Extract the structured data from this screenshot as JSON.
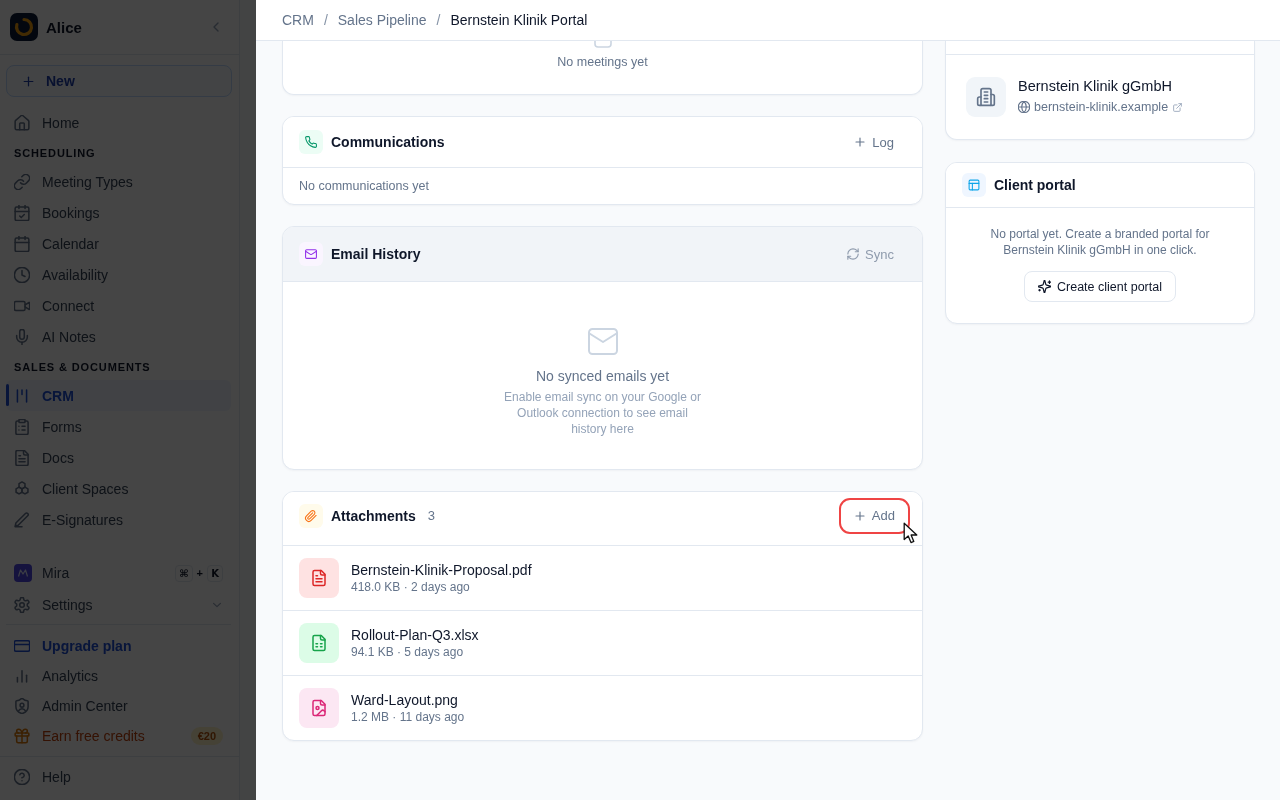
{
  "sidebar": {
    "dimmed": true,
    "workspace": "Alice",
    "new_button": "New",
    "home": {
      "label": "Home",
      "selected": false
    },
    "sections": [
      {
        "title": "SCHEDULING",
        "items": [
          {
            "label": "Meeting Types",
            "selected": false
          },
          {
            "label": "Bookings",
            "selected": false
          },
          {
            "label": "Calendar",
            "selected": false
          },
          {
            "label": "Availability",
            "selected": false
          },
          {
            "label": "Connect",
            "selected": false
          },
          {
            "label": "AI Notes",
            "selected": false
          }
        ]
      },
      {
        "title": "SALES & DOCUMENTS",
        "items": [
          {
            "label": "CRM",
            "selected": true
          },
          {
            "label": "Forms",
            "selected": false
          },
          {
            "label": "Docs",
            "selected": false
          },
          {
            "label": "Client Spaces",
            "selected": false
          },
          {
            "label": "E-Signatures",
            "selected": false
          }
        ]
      }
    ],
    "assistant": {
      "label": "Mira",
      "shortcut": {
        "keys": [
          "⌘",
          "K"
        ],
        "joiner": "+"
      }
    },
    "settings": {
      "label": "Settings",
      "expanded": false
    },
    "footer_items": [
      {
        "kind": "upgrade",
        "label": "Upgrade plan"
      },
      {
        "kind": "link",
        "label": "Analytics"
      },
      {
        "kind": "link",
        "label": "Admin Center"
      },
      {
        "kind": "promo",
        "label": "Earn free credits",
        "badge": "€20"
      }
    ],
    "help": "Help"
  },
  "breadcrumb": [
    {
      "label": "CRM",
      "current": false
    },
    {
      "separator": "/",
      "label": "Sales Pipeline",
      "current": false
    },
    {
      "separator": "/",
      "label": "Bernstein Klinik Portal",
      "current": true
    }
  ],
  "main": {
    "meetings": {
      "empty_text": "No meetings yet"
    },
    "communications": {
      "title": "Communications",
      "hovered": false,
      "action": {
        "label": "Log",
        "disabled": false,
        "highlighted": false
      },
      "empty_text": "No communications yet"
    },
    "email_history": {
      "title": "Email History",
      "hovered": true,
      "action": {
        "label": "Sync",
        "disabled": true,
        "highlighted": false
      },
      "empty_title": "No synced emails yet",
      "empty_text": "Enable email sync on your Google or Outlook connection to see email history here"
    },
    "attachments": {
      "title": "Attachments",
      "count": "3",
      "hovered": false,
      "action": {
        "label": "Add",
        "disabled": false,
        "highlighted": true
      },
      "files": [
        {
          "kind": "pdf",
          "name": "Bernstein-Klinik-Proposal.pdf",
          "meta": "418.0 KB · 2 days ago"
        },
        {
          "kind": "spreadsheet",
          "name": "Rollout-Plan-Q3.xlsx",
          "meta": "94.1 KB · 5 days ago"
        },
        {
          "kind": "image",
          "name": "Ward-Layout.png",
          "meta": "1.2 MB · 11 days ago"
        }
      ]
    }
  },
  "aside": {
    "company": {
      "name": "Bernstein Klinik gGmbH",
      "website": "bernstein-klinik.example"
    },
    "client_portal": {
      "title": "Client portal",
      "text": "No portal yet. Create a branded portal for Bernstein Klinik gGmbH in one click.",
      "button": "Create client portal"
    }
  }
}
